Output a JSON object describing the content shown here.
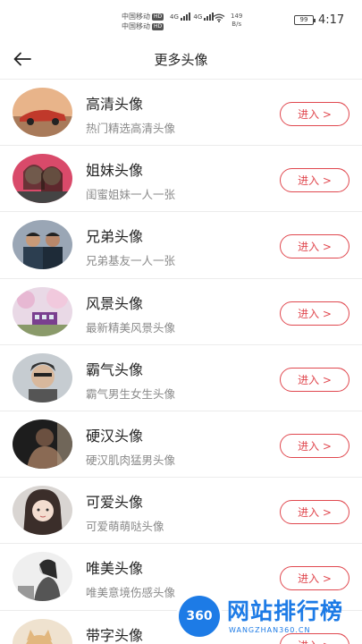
{
  "status_bar": {
    "carrier_1": "中国移动",
    "carrier_2": "中国移动",
    "hd": "HD",
    "network_1": "4G",
    "network_2": "4G",
    "speed_value": "149",
    "speed_unit": "B/s",
    "battery": "99",
    "time": "4:17"
  },
  "header": {
    "title": "更多头像"
  },
  "items": [
    {
      "title": "高清头像",
      "subtitle": "热门精选高清头像",
      "button": "进入 >"
    },
    {
      "title": "姐妹头像",
      "subtitle": "闺蜜姐妹一人一张",
      "button": "进入 >"
    },
    {
      "title": "兄弟头像",
      "subtitle": "兄弟基友一人一张",
      "button": "进入 >"
    },
    {
      "title": "风景头像",
      "subtitle": "最新精美风景头像",
      "button": "进入 >"
    },
    {
      "title": "霸气头像",
      "subtitle": "霸气男生女生头像",
      "button": "进入 >"
    },
    {
      "title": "硬汉头像",
      "subtitle": "硬汉肌肉猛男头像",
      "button": "进入 >"
    },
    {
      "title": "可爱头像",
      "subtitle": "可爱萌萌哒头像",
      "button": "进入 >"
    },
    {
      "title": "唯美头像",
      "subtitle": "唯美意境伤感头像",
      "button": "进入 >"
    },
    {
      "title": "带字头像",
      "subtitle": "",
      "button": "进入 >"
    }
  ],
  "watermark": {
    "badge": "360",
    "title": "网站排行榜",
    "subtitle": "WANGZHAN360.CN"
  }
}
